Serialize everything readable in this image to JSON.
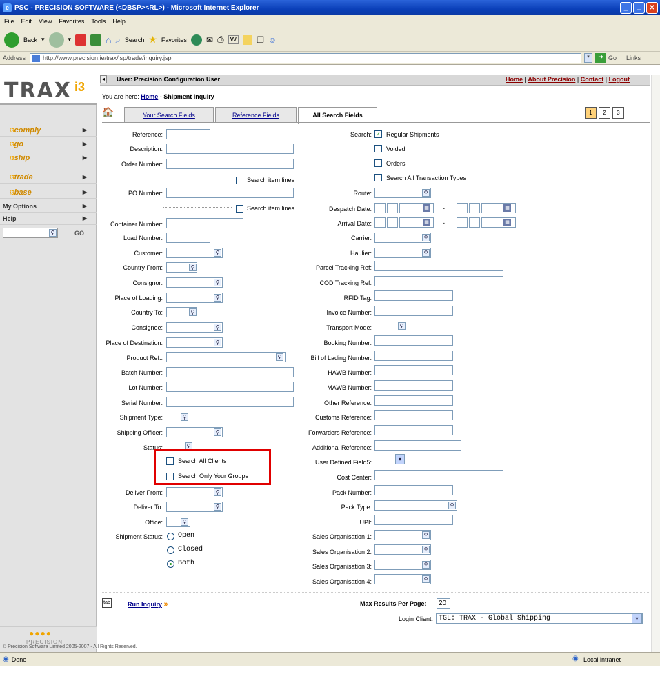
{
  "window": {
    "title": "PSC - PRECISION SOFTWARE (<DBSP><RL>) - Microsoft Internet Explorer",
    "menu": [
      "File",
      "Edit",
      "View",
      "Favorites",
      "Tools",
      "Help"
    ],
    "toolbar": {
      "back": "Back",
      "search": "Search",
      "favorites": "Favorites"
    },
    "address_label": "Address",
    "address": "http://www.precision.ie/trax/jsp/trade/inquiry.jsp",
    "go": "Go",
    "links": "Links",
    "status": "Done",
    "zone": "Local intranet"
  },
  "sidebar": {
    "items": [
      "comply",
      "go",
      "ship",
      "trade",
      "base",
      "My Options",
      "Help"
    ],
    "go_label": "GO",
    "copyright": "© Precision Software Limited 2005-2007 - All Rights Reserved."
  },
  "header": {
    "user": "User: Precision Configuration User",
    "links": [
      "Home",
      "About Precision",
      "Contact",
      "Logout"
    ],
    "breadcrumb_prefix": "You are here:",
    "breadcrumb_home": "Home",
    "breadcrumb_page": "- Shipment Inquiry"
  },
  "tabs": [
    "Your Search Fields",
    "Reference Fields",
    "All Search Fields"
  ],
  "pages": [
    "1",
    "2",
    "3"
  ],
  "left_labels": {
    "reference": "Reference:",
    "description": "Description:",
    "order_number": "Order Number:",
    "po_number": "PO Number:",
    "container_number": "Container Number:",
    "load_number": "Load Number:",
    "customer": "Customer:",
    "country_from": "Country From:",
    "consignor": "Consignor:",
    "place_of_loading": "Place of Loading:",
    "country_to": "Country To:",
    "consignee": "Consignee:",
    "place_of_destination": "Place of Destination:",
    "product_ref": "Product Ref.:",
    "batch_number": "Batch Number:",
    "lot_number": "Lot Number:",
    "serial_number": "Serial Number:",
    "shipment_type": "Shipment Type:",
    "shipping_officer": "Shipping Officer:",
    "status": "Status:",
    "deliver_from": "Deliver From:",
    "deliver_to": "Deliver To:",
    "office": "Office:",
    "shipment_status": "Shipment Status:"
  },
  "search_item_lines": "Search item lines",
  "search_all_clients": "Search All Clients",
  "search_only_groups": "Search Only Your Groups",
  "shipment_status_options": [
    "Open",
    "Closed",
    "Both"
  ],
  "right_labels": {
    "search": "Search:",
    "route": "Route:",
    "despatch_date": "Despatch Date:",
    "arrival_date": "Arrival Date:",
    "carrier": "Carrier:",
    "haulier": "Haulier:",
    "parcel_tracking": "Parcel Tracking Ref:",
    "cod_tracking": "COD Tracking Ref:",
    "rfid": "RFID Tag:",
    "invoice": "Invoice Number:",
    "transport_mode": "Transport Mode:",
    "booking": "Booking Number:",
    "bill_of_lading": "Bill of Lading Number:",
    "hawb": "HAWB Number:",
    "mawb": "MAWB Number:",
    "other_ref": "Other Reference:",
    "customs_ref": "Customs Reference:",
    "forwarders_ref": "Forwarders Reference:",
    "additional_ref": "Additional Reference:",
    "udf5": "User Defined Field5:",
    "cost_center": "Cost Center:",
    "pack_number": "Pack Number:",
    "pack_type": "Pack Type:",
    "upi": "UPI:",
    "sales_org_1": "Sales Organisation 1:",
    "sales_org_2": "Sales Organisation 2:",
    "sales_org_3": "Sales Organisation 3:",
    "sales_org_4": "Sales Organisation 4:"
  },
  "search_options": [
    "Regular Shipments",
    "Voided",
    "Orders",
    "Search All Transaction Types"
  ],
  "footer": {
    "run_inquiry": "Run Inquiry",
    "max_results_label": "Max Results Per Page:",
    "max_results_value": "20",
    "login_client_label": "Login Client:",
    "login_client_value": "TGL: TRAX - Global Shipping"
  }
}
